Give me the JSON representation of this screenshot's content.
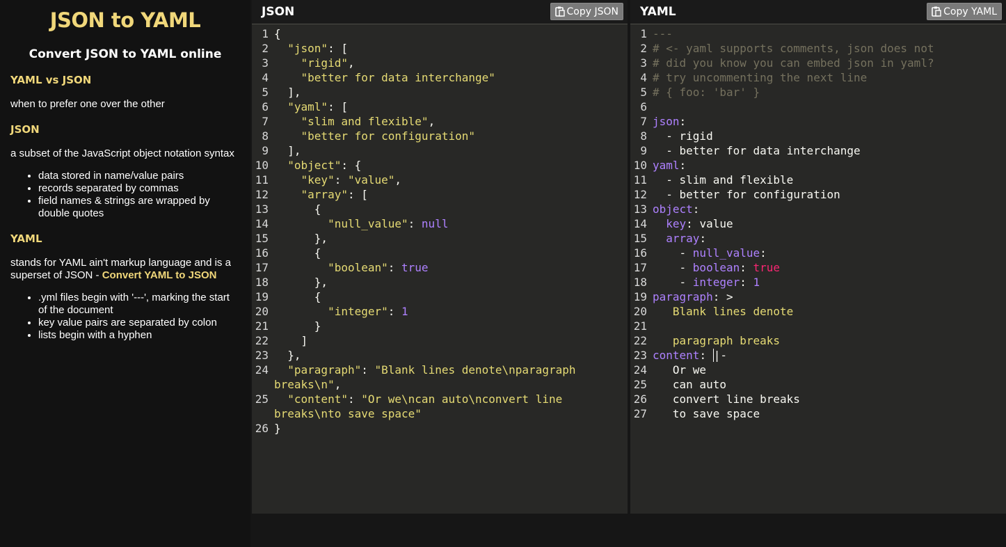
{
  "sidebar": {
    "title": "JSON to YAML",
    "subtitle": "Convert JSON to YAML online",
    "vs_heading": "YAML vs JSON",
    "vs_text": "when to prefer one over the other",
    "json_heading": "JSON",
    "json_text": "a subset of the JavaScript object notation syntax",
    "json_list": [
      "data stored in name/value pairs",
      "records separated by commas",
      "field names & strings are wrapped by double quotes"
    ],
    "yaml_heading": "YAML",
    "yaml_text": "stands for YAML ain't markup language and is a superset of JSON - ",
    "yaml_link": "Convert YAML to JSON",
    "yaml_list": [
      ".yml files begin with '---', marking the start of the document",
      "key value pairs are separated by colon",
      "lists begin with a hyphen"
    ]
  },
  "json_panel": {
    "title": "JSON",
    "copy_label": "Copy JSON",
    "lines": [
      {
        "n": "1",
        "parts": [
          {
            "t": "{",
            "c": "txt"
          }
        ]
      },
      {
        "n": "2",
        "parts": [
          {
            "t": "  \"json\"",
            "c": "str"
          },
          {
            "t": ": [",
            "c": "txt"
          }
        ]
      },
      {
        "n": "3",
        "parts": [
          {
            "t": "    \"rigid\"",
            "c": "str"
          },
          {
            "t": ",",
            "c": "txt"
          }
        ]
      },
      {
        "n": "4",
        "parts": [
          {
            "t": "    \"better for data interchange\"",
            "c": "str"
          }
        ]
      },
      {
        "n": "5",
        "parts": [
          {
            "t": "  ],",
            "c": "txt"
          }
        ]
      },
      {
        "n": "6",
        "parts": [
          {
            "t": "  \"yaml\"",
            "c": "str"
          },
          {
            "t": ": [",
            "c": "txt"
          }
        ]
      },
      {
        "n": "7",
        "parts": [
          {
            "t": "    \"slim and flexible\"",
            "c": "str"
          },
          {
            "t": ",",
            "c": "txt"
          }
        ]
      },
      {
        "n": "8",
        "parts": [
          {
            "t": "    \"better for configuration\"",
            "c": "str"
          }
        ]
      },
      {
        "n": "9",
        "parts": [
          {
            "t": "  ],",
            "c": "txt"
          }
        ]
      },
      {
        "n": "10",
        "parts": [
          {
            "t": "  \"object\"",
            "c": "str"
          },
          {
            "t": ": {",
            "c": "txt"
          }
        ]
      },
      {
        "n": "11",
        "parts": [
          {
            "t": "    \"key\"",
            "c": "str"
          },
          {
            "t": ": ",
            "c": "txt"
          },
          {
            "t": "\"value\"",
            "c": "str"
          },
          {
            "t": ",",
            "c": "txt"
          }
        ]
      },
      {
        "n": "12",
        "parts": [
          {
            "t": "    \"array\"",
            "c": "str"
          },
          {
            "t": ": [",
            "c": "txt"
          }
        ]
      },
      {
        "n": "13",
        "parts": [
          {
            "t": "      {",
            "c": "txt"
          }
        ]
      },
      {
        "n": "14",
        "parts": [
          {
            "t": "        \"null_value\"",
            "c": "str"
          },
          {
            "t": ": ",
            "c": "txt"
          },
          {
            "t": "null",
            "c": "kw"
          }
        ]
      },
      {
        "n": "15",
        "parts": [
          {
            "t": "      },",
            "c": "txt"
          }
        ]
      },
      {
        "n": "16",
        "parts": [
          {
            "t": "      {",
            "c": "txt"
          }
        ]
      },
      {
        "n": "17",
        "parts": [
          {
            "t": "        \"boolean\"",
            "c": "str"
          },
          {
            "t": ": ",
            "c": "txt"
          },
          {
            "t": "true",
            "c": "kw"
          }
        ]
      },
      {
        "n": "18",
        "parts": [
          {
            "t": "      },",
            "c": "txt"
          }
        ]
      },
      {
        "n": "19",
        "parts": [
          {
            "t": "      {",
            "c": "txt"
          }
        ]
      },
      {
        "n": "20",
        "parts": [
          {
            "t": "        \"integer\"",
            "c": "str"
          },
          {
            "t": ": ",
            "c": "txt"
          },
          {
            "t": "1",
            "c": "kw"
          }
        ]
      },
      {
        "n": "21",
        "parts": [
          {
            "t": "      }",
            "c": "txt"
          }
        ]
      },
      {
        "n": "22",
        "parts": [
          {
            "t": "    ]",
            "c": "txt"
          }
        ]
      },
      {
        "n": "23",
        "parts": [
          {
            "t": "  },",
            "c": "txt"
          }
        ]
      },
      {
        "n": "24",
        "parts": [
          {
            "t": "  \"paragraph\"",
            "c": "str"
          },
          {
            "t": ": ",
            "c": "txt"
          },
          {
            "t": "\"Blank lines denote\\nparagraph",
            "c": "str"
          }
        ]
      },
      {
        "n": "",
        "parts": [
          {
            "t": "breaks\\n\"",
            "c": "str"
          },
          {
            "t": ",",
            "c": "txt"
          }
        ]
      },
      {
        "n": "25",
        "parts": [
          {
            "t": "  \"content\"",
            "c": "str"
          },
          {
            "t": ": ",
            "c": "txt"
          },
          {
            "t": "\"Or we\\ncan auto\\nconvert line",
            "c": "str"
          }
        ]
      },
      {
        "n": "",
        "parts": [
          {
            "t": "breaks\\nto save space\"",
            "c": "str"
          }
        ]
      },
      {
        "n": "26",
        "parts": [
          {
            "t": "}",
            "c": "txt"
          }
        ]
      }
    ]
  },
  "yaml_panel": {
    "title": "YAML",
    "copy_label": "Copy YAML",
    "lines": [
      {
        "n": "1",
        "parts": [
          {
            "t": "---",
            "c": "com"
          }
        ]
      },
      {
        "n": "2",
        "parts": [
          {
            "t": "# <- yaml supports comments, json does not",
            "c": "com"
          }
        ]
      },
      {
        "n": "3",
        "parts": [
          {
            "t": "# did you know you can embed json in yaml?",
            "c": "com"
          }
        ]
      },
      {
        "n": "4",
        "parts": [
          {
            "t": "# try uncommenting the next line",
            "c": "com"
          }
        ]
      },
      {
        "n": "5",
        "parts": [
          {
            "t": "# { foo: 'bar' }",
            "c": "com"
          }
        ]
      },
      {
        "n": "6",
        "parts": [
          {
            "t": "",
            "c": "txt"
          }
        ]
      },
      {
        "n": "7",
        "parts": [
          {
            "t": "json",
            "c": "key"
          },
          {
            "t": ":",
            "c": "txt"
          }
        ]
      },
      {
        "n": "8",
        "parts": [
          {
            "t": "  - rigid",
            "c": "txt"
          }
        ]
      },
      {
        "n": "9",
        "parts": [
          {
            "t": "  - better for data interchange",
            "c": "txt"
          }
        ]
      },
      {
        "n": "10",
        "parts": [
          {
            "t": "yaml",
            "c": "key"
          },
          {
            "t": ":",
            "c": "txt"
          }
        ]
      },
      {
        "n": "11",
        "parts": [
          {
            "t": "  - slim and flexible",
            "c": "txt"
          }
        ]
      },
      {
        "n": "12",
        "parts": [
          {
            "t": "  - better for configuration",
            "c": "txt"
          }
        ]
      },
      {
        "n": "13",
        "parts": [
          {
            "t": "object",
            "c": "key"
          },
          {
            "t": ":",
            "c": "txt"
          }
        ]
      },
      {
        "n": "14",
        "parts": [
          {
            "t": "  ",
            "c": "txt"
          },
          {
            "t": "key",
            "c": "key"
          },
          {
            "t": ": value",
            "c": "txt"
          }
        ]
      },
      {
        "n": "15",
        "parts": [
          {
            "t": "  ",
            "c": "txt"
          },
          {
            "t": "array",
            "c": "key"
          },
          {
            "t": ":",
            "c": "txt"
          }
        ]
      },
      {
        "n": "16",
        "parts": [
          {
            "t": "    - ",
            "c": "txt"
          },
          {
            "t": "null_value",
            "c": "key"
          },
          {
            "t": ":",
            "c": "txt"
          }
        ]
      },
      {
        "n": "17",
        "parts": [
          {
            "t": "    - ",
            "c": "txt"
          },
          {
            "t": "boolean",
            "c": "key"
          },
          {
            "t": ": ",
            "c": "txt"
          },
          {
            "t": "true",
            "c": "bool"
          }
        ]
      },
      {
        "n": "18",
        "parts": [
          {
            "t": "    - ",
            "c": "txt"
          },
          {
            "t": "integer",
            "c": "key"
          },
          {
            "t": ": ",
            "c": "txt"
          },
          {
            "t": "1",
            "c": "kw"
          }
        ]
      },
      {
        "n": "19",
        "parts": [
          {
            "t": "paragraph",
            "c": "key"
          },
          {
            "t": ": >",
            "c": "txt"
          }
        ]
      },
      {
        "n": "20",
        "parts": [
          {
            "t": "   Blank lines denote",
            "c": "str"
          }
        ]
      },
      {
        "n": "21",
        "parts": [
          {
            "t": "",
            "c": "txt"
          }
        ]
      },
      {
        "n": "22",
        "parts": [
          {
            "t": "   paragraph breaks",
            "c": "str"
          }
        ]
      },
      {
        "n": "23",
        "parts": [
          {
            "t": "content",
            "c": "key"
          },
          {
            "t": ": ",
            "c": "txt"
          },
          {
            "t": "|-",
            "c": "txt cursor"
          }
        ]
      },
      {
        "n": "24",
        "parts": [
          {
            "t": "   Or we",
            "c": "txt"
          }
        ]
      },
      {
        "n": "25",
        "parts": [
          {
            "t": "   can auto",
            "c": "txt"
          }
        ]
      },
      {
        "n": "26",
        "parts": [
          {
            "t": "   convert line breaks",
            "c": "txt"
          }
        ]
      },
      {
        "n": "27",
        "parts": [
          {
            "t": "   to save space",
            "c": "txt"
          }
        ]
      }
    ]
  },
  "icons": {
    "copy": "clipboard-icon"
  }
}
